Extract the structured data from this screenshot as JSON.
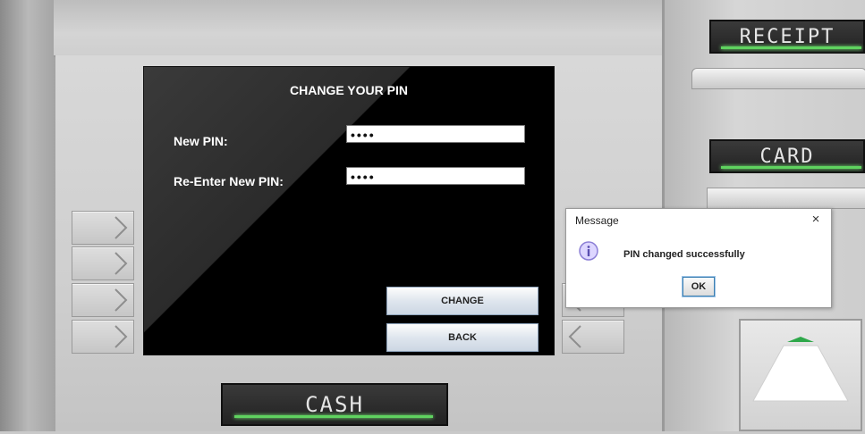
{
  "screen": {
    "title": "CHANGE YOUR PIN",
    "new_pin_label": "New PIN:",
    "new_pin_value": "••••",
    "reenter_label": "Re-Enter New PIN:",
    "reenter_value": "••••",
    "change_button": "CHANGE",
    "back_button": "BACK"
  },
  "slots": {
    "receipt_label": "RECEIPT",
    "card_label": "CARD",
    "cash_label": "CASH"
  },
  "dialog": {
    "title": "Message",
    "close": "×",
    "message": "PIN changed successfully",
    "ok_label": "OK"
  },
  "colors": {
    "indicator_green": "#5fd35f",
    "info_icon": "#8c7fd6"
  }
}
